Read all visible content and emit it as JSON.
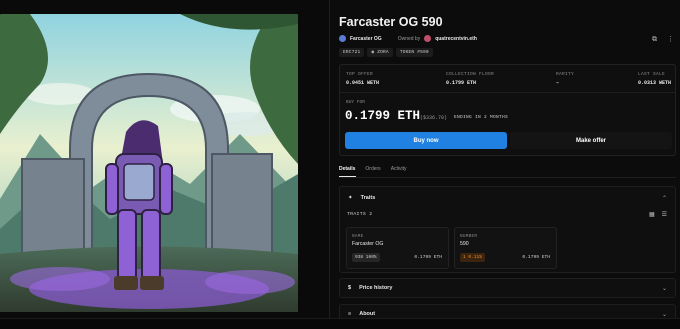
{
  "nft": {
    "title": "Farcaster OG 590",
    "collection": "Farcaster OG",
    "owned_by_label": "Owned by",
    "owner": "quatrecentvin.eth",
    "tags": [
      "ERC721",
      "ZORA",
      "TOKEN #590"
    ]
  },
  "stats": [
    {
      "label": "TOP OFFER",
      "value": "0.0451 WETH"
    },
    {
      "label": "COLLECTION FLOOR",
      "value": "0.1799 ETH"
    },
    {
      "label": "RARITY",
      "value": "–"
    },
    {
      "label": "LAST SALE",
      "value": "0.0313 WETH"
    }
  ],
  "buy": {
    "label": "BUY FOR",
    "price": "0.1799 ETH",
    "usd": "($336.70)",
    "ending": "ENDING IN 2 MONTHS",
    "buy_now": "Buy now",
    "make_offer": "Make offer"
  },
  "tabs": [
    "Details",
    "Orders",
    "Activity"
  ],
  "traits": {
    "heading": "Traits",
    "count_label": "TRAITS",
    "count": "2",
    "items": [
      {
        "label": "NAME",
        "value": "Farcaster OG",
        "chip": "938 100%",
        "price": "0.1799 ETH"
      },
      {
        "label": "NUMBER",
        "value": "590",
        "chip": "1 0.11%",
        "price": "0.1799 ETH"
      }
    ]
  },
  "sections": {
    "price_history": "Price history",
    "about": "About"
  },
  "colors": {
    "accent": "#2081e2",
    "rare_chip": "#f08a24",
    "background": "#0a0a0a"
  }
}
